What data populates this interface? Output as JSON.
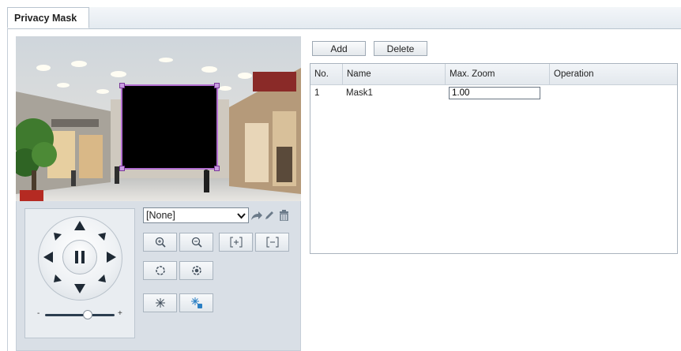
{
  "tab": {
    "title": "Privacy Mask"
  },
  "preview": {
    "preset_value": "[None]"
  },
  "toolbar": {
    "add_label": "Add",
    "delete_label": "Delete"
  },
  "table": {
    "columns": [
      "No.",
      "Name",
      "Max. Zoom",
      "Operation"
    ],
    "rows": [
      {
        "no": "1",
        "name": "Mask1",
        "max_zoom": "1.00",
        "operation": ""
      }
    ]
  },
  "icons": {
    "ptz": [
      "arrow-up-icon",
      "arrow-down-icon",
      "arrow-left-icon",
      "arrow-right-icon",
      "arrow-up-left-icon",
      "arrow-up-right-icon",
      "arrow-down-left-icon",
      "arrow-down-right-icon",
      "pause-icon"
    ],
    "controls": [
      "zoom-in-icon",
      "zoom-out-icon",
      "focus-near-icon",
      "focus-far-icon",
      "iris-open-icon",
      "iris-close-icon",
      "wiper-icon",
      "light-icon"
    ],
    "preset_actions": [
      "goto-icon",
      "edit-icon",
      "delete-icon"
    ]
  },
  "colors": {
    "mask_border": "#b36fd1",
    "panel_bg": "#d9dfe6",
    "accent_icon": "#2a7fc4"
  }
}
